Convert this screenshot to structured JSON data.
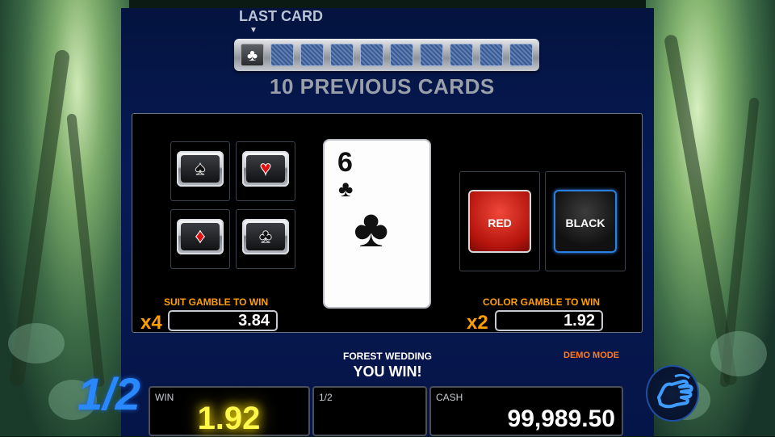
{
  "history": {
    "label": "LAST CARD",
    "last_card_suit": "♣",
    "previous_label": "10 PREVIOUS CARDS"
  },
  "suits": [
    {
      "name": "spade",
      "glyph": "♠",
      "color": "#111111"
    },
    {
      "name": "heart",
      "glyph": "♥",
      "color": "#e01010"
    },
    {
      "name": "diamond",
      "glyph": "♦",
      "color": "#e01010"
    },
    {
      "name": "club",
      "glyph": "♣",
      "color": "#111111"
    }
  ],
  "card": {
    "rank": "6",
    "suit": "♣"
  },
  "colors": {
    "red_label": "RED",
    "black_label": "BLACK"
  },
  "suit_gamble": {
    "label": "SUIT GAMBLE TO WIN",
    "multiplier": "x4",
    "value": "3.84"
  },
  "color_gamble": {
    "label": "COLOR GAMBLE TO WIN",
    "multiplier": "x2",
    "value": "1.92"
  },
  "status": {
    "game_title": "FOREST WEDDING",
    "message": "YOU WIN!",
    "mode": "DEMO MODE"
  },
  "half_button": "1/2",
  "bottom": {
    "win_label": "WIN",
    "win_value": "1.92",
    "half_label": "1/2",
    "cash_label": "CASH",
    "cash_value": "99,989.50"
  },
  "accent_colors": {
    "orange": "#ffa000",
    "blue": "#2a88ff",
    "win_yellow": "#fff84a"
  }
}
